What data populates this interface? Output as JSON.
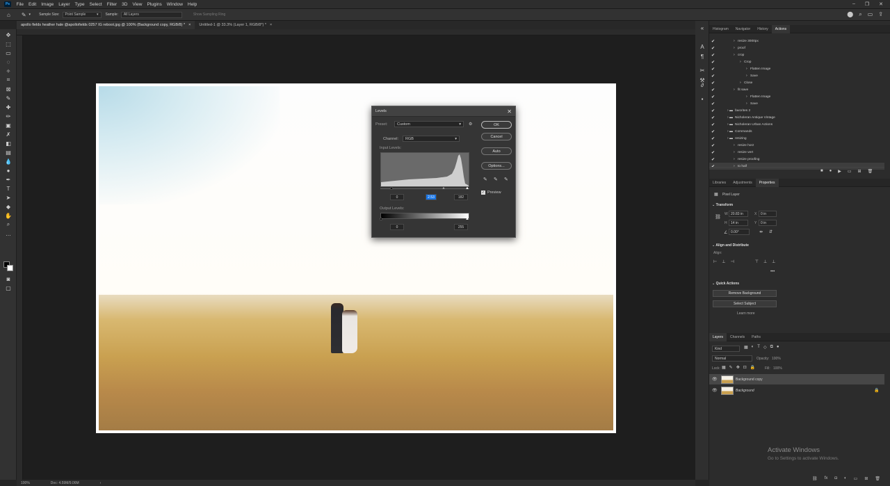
{
  "menubar": {
    "logo": "Ps",
    "items": [
      "File",
      "Edit",
      "Image",
      "Layer",
      "Type",
      "Select",
      "Filter",
      "3D",
      "View",
      "Plugins",
      "Window",
      "Help"
    ]
  },
  "optbar": {
    "sample_size_label": "Sample Size:",
    "sample_size_value": "Point Sample",
    "sample_label": "Sample:",
    "sample_value": "All Layers",
    "sampling_ring": "Show Sampling Ring"
  },
  "tabs": [
    {
      "label": "apollo fields heather hale @apollofields 0257  IG reboot.jpg @ 100% (Background copy, RGB/8) *",
      "active": true
    },
    {
      "label": "Untitled-1 @ 33.3% (Layer 1, RGB/8*) *",
      "active": false
    }
  ],
  "statusbar": {
    "zoom": "100%",
    "doc": "Doc: 4.59M/9.06M"
  },
  "levels": {
    "title": "Levels",
    "preset_label": "Preset:",
    "preset_value": "Custom",
    "channel_label": "Channel:",
    "channel_value": "RGB",
    "input_label": "Input Levels:",
    "input_black": "0",
    "input_gamma": "2.53",
    "input_white": "182",
    "output_label": "Output Levels:",
    "output_black": "0",
    "output_white": "255",
    "ok": "OK",
    "cancel": "Cancel",
    "auto": "Auto",
    "options": "Options...",
    "preview": "Preview",
    "close_icon": "close-icon"
  },
  "actions_panel": {
    "tabs": [
      "Histogram",
      "Navigator",
      "History",
      "Actions"
    ],
    "active_tab": "Actions",
    "rows": [
      {
        "label": "resize 3000px",
        "indent": 3
      },
      {
        "label": "proof",
        "indent": 3
      },
      {
        "label": "crop",
        "indent": 3
      },
      {
        "label": "Crop",
        "indent": 4
      },
      {
        "label": "Flatten Image",
        "indent": 5
      },
      {
        "label": "Save",
        "indent": 5
      },
      {
        "label": "Close",
        "indent": 4
      },
      {
        "label": "fit save",
        "indent": 3
      },
      {
        "label": "Flatten Image",
        "indent": 5
      },
      {
        "label": "Save",
        "indent": 5
      },
      {
        "label": "favorites 2",
        "indent": 2,
        "folder": true
      },
      {
        "label": "Nicholeran Antique Vintage",
        "indent": 2,
        "folder": true
      },
      {
        "label": "Nicholeran Urban Actions",
        "indent": 2,
        "folder": true
      },
      {
        "label": "Commands",
        "indent": 2,
        "folder": true
      },
      {
        "label": "resizing",
        "indent": 2,
        "folder": true
      },
      {
        "label": "resize horz",
        "indent": 3
      },
      {
        "label": "resize vert",
        "indent": 3
      },
      {
        "label": "resize proofing",
        "indent": 3
      },
      {
        "label": "to half",
        "indent": 3
      }
    ]
  },
  "properties_panel": {
    "tabs": [
      "Libraries",
      "Adjustments",
      "Properties"
    ],
    "active_tab": "Properties",
    "layer_type": "Pixel Layer",
    "transform": "Transform",
    "w_label": "W",
    "w_value": "20.83 in",
    "x_label": "X",
    "x_value": "0 in",
    "h_label": "H",
    "h_value": "14 in",
    "y_label": "Y",
    "y_value": "0 in",
    "angle": "0.00°",
    "align_section": "Align and Distribute",
    "align_label": "Align:",
    "more": "•••",
    "quick_actions": "Quick Actions",
    "remove_bg": "Remove Background",
    "select_subject": "Select Subject",
    "learn_more": "Learn more"
  },
  "layers_panel": {
    "tabs": [
      "Layers",
      "Channels",
      "Paths"
    ],
    "active_tab": "Layers",
    "kind": "Kind",
    "blend": "Normal",
    "opacity_label": "Opacity:",
    "opacity": "100%",
    "lock_label": "Lock:",
    "fill_label": "Fill:",
    "fill": "100%",
    "layers": [
      {
        "name": "Background copy",
        "selected": true
      },
      {
        "name": "Background",
        "selected": false
      }
    ]
  },
  "watermark": {
    "title": "Activate Windows",
    "sub": "Go to Settings to activate Windows."
  }
}
